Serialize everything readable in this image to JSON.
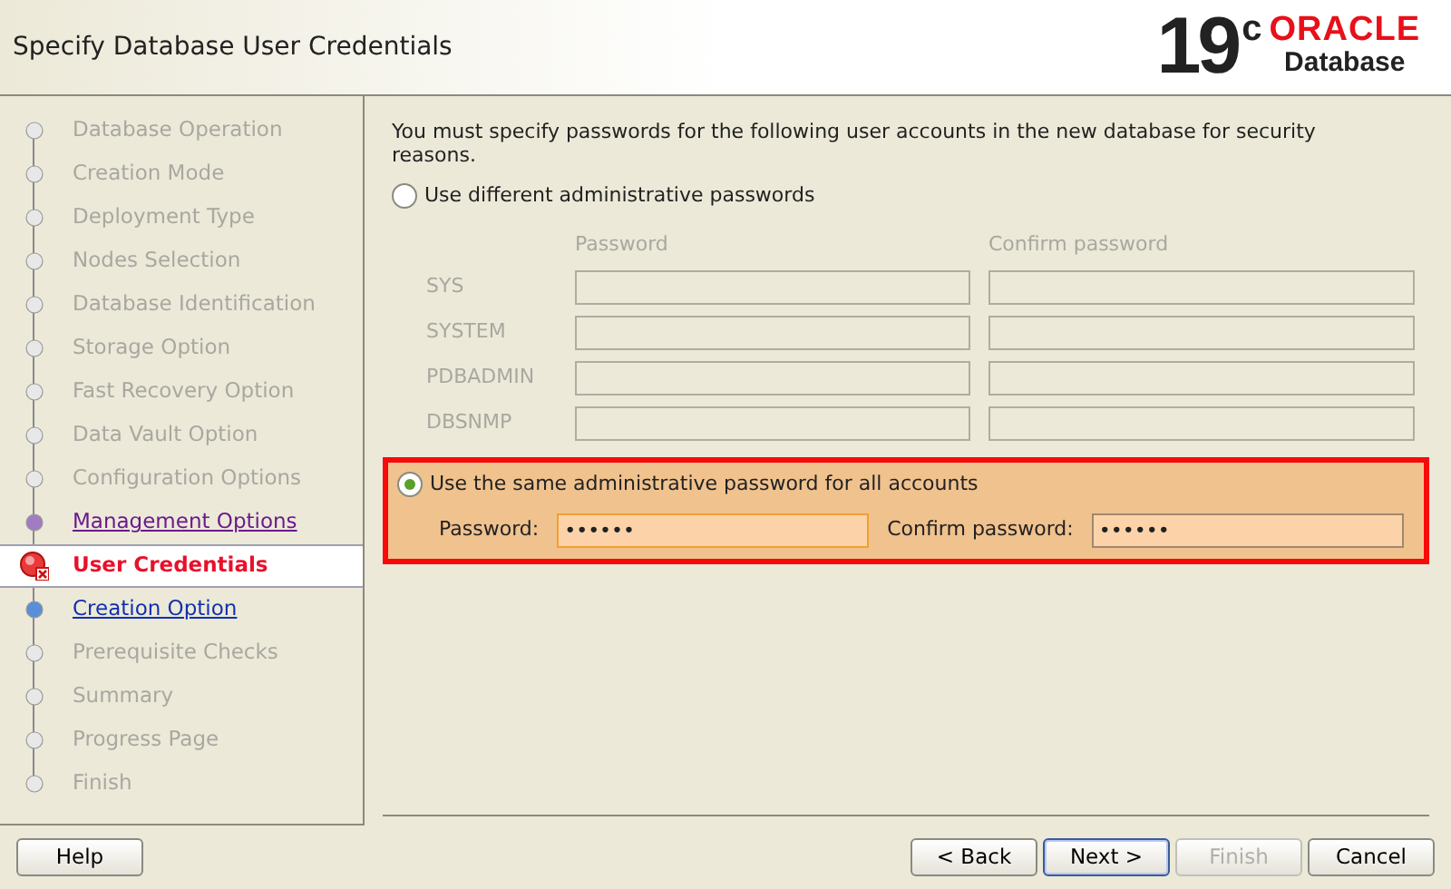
{
  "header": {
    "title": "Specify Database User Credentials",
    "logo": {
      "version": "19",
      "version_suffix": "c",
      "brand": "ORACLE",
      "product": "Database"
    }
  },
  "steps": [
    {
      "label": "Database Operation",
      "kind": "pending"
    },
    {
      "label": "Creation Mode",
      "kind": "pending"
    },
    {
      "label": "Deployment Type",
      "kind": "pending"
    },
    {
      "label": "Nodes Selection",
      "kind": "pending"
    },
    {
      "label": "Database Identification",
      "kind": "pending"
    },
    {
      "label": "Storage Option",
      "kind": "pending"
    },
    {
      "label": "Fast Recovery Option",
      "kind": "pending"
    },
    {
      "label": "Data Vault Option",
      "kind": "pending"
    },
    {
      "label": "Configuration Options",
      "kind": "pending"
    },
    {
      "label": "Management Options",
      "kind": "visited"
    },
    {
      "label": "User Credentials",
      "kind": "current"
    },
    {
      "label": "Creation Option",
      "kind": "next"
    },
    {
      "label": "Prerequisite Checks",
      "kind": "pending"
    },
    {
      "label": "Summary",
      "kind": "pending"
    },
    {
      "label": "Progress Page",
      "kind": "pending"
    },
    {
      "label": "Finish",
      "kind": "pending"
    }
  ],
  "intro": "You must specify passwords for the following user accounts in the new database for security reasons.",
  "different_option": {
    "label": "Use different administrative passwords",
    "selected": false,
    "columns": [
      "Password",
      "Confirm password"
    ],
    "accounts": [
      "SYS",
      "SYSTEM",
      "PDBADMIN",
      "DBSNMP"
    ]
  },
  "same_option": {
    "label": "Use the same administrative password for all accounts",
    "selected": true,
    "error": true,
    "password": {
      "label": "Password:",
      "value": "••••••"
    },
    "confirm": {
      "label": "Confirm password:",
      "value": "••••••"
    }
  },
  "buttons": [
    {
      "label": "Help",
      "kind": "left",
      "disabled": false
    },
    {
      "label": "< Back",
      "kind": "right",
      "disabled": false
    },
    {
      "label": "Next >",
      "kind": "default",
      "disabled": false
    },
    {
      "label": "Finish",
      "kind": "right",
      "disabled": true
    },
    {
      "label": "Cancel",
      "kind": "right",
      "disabled": false
    }
  ]
}
